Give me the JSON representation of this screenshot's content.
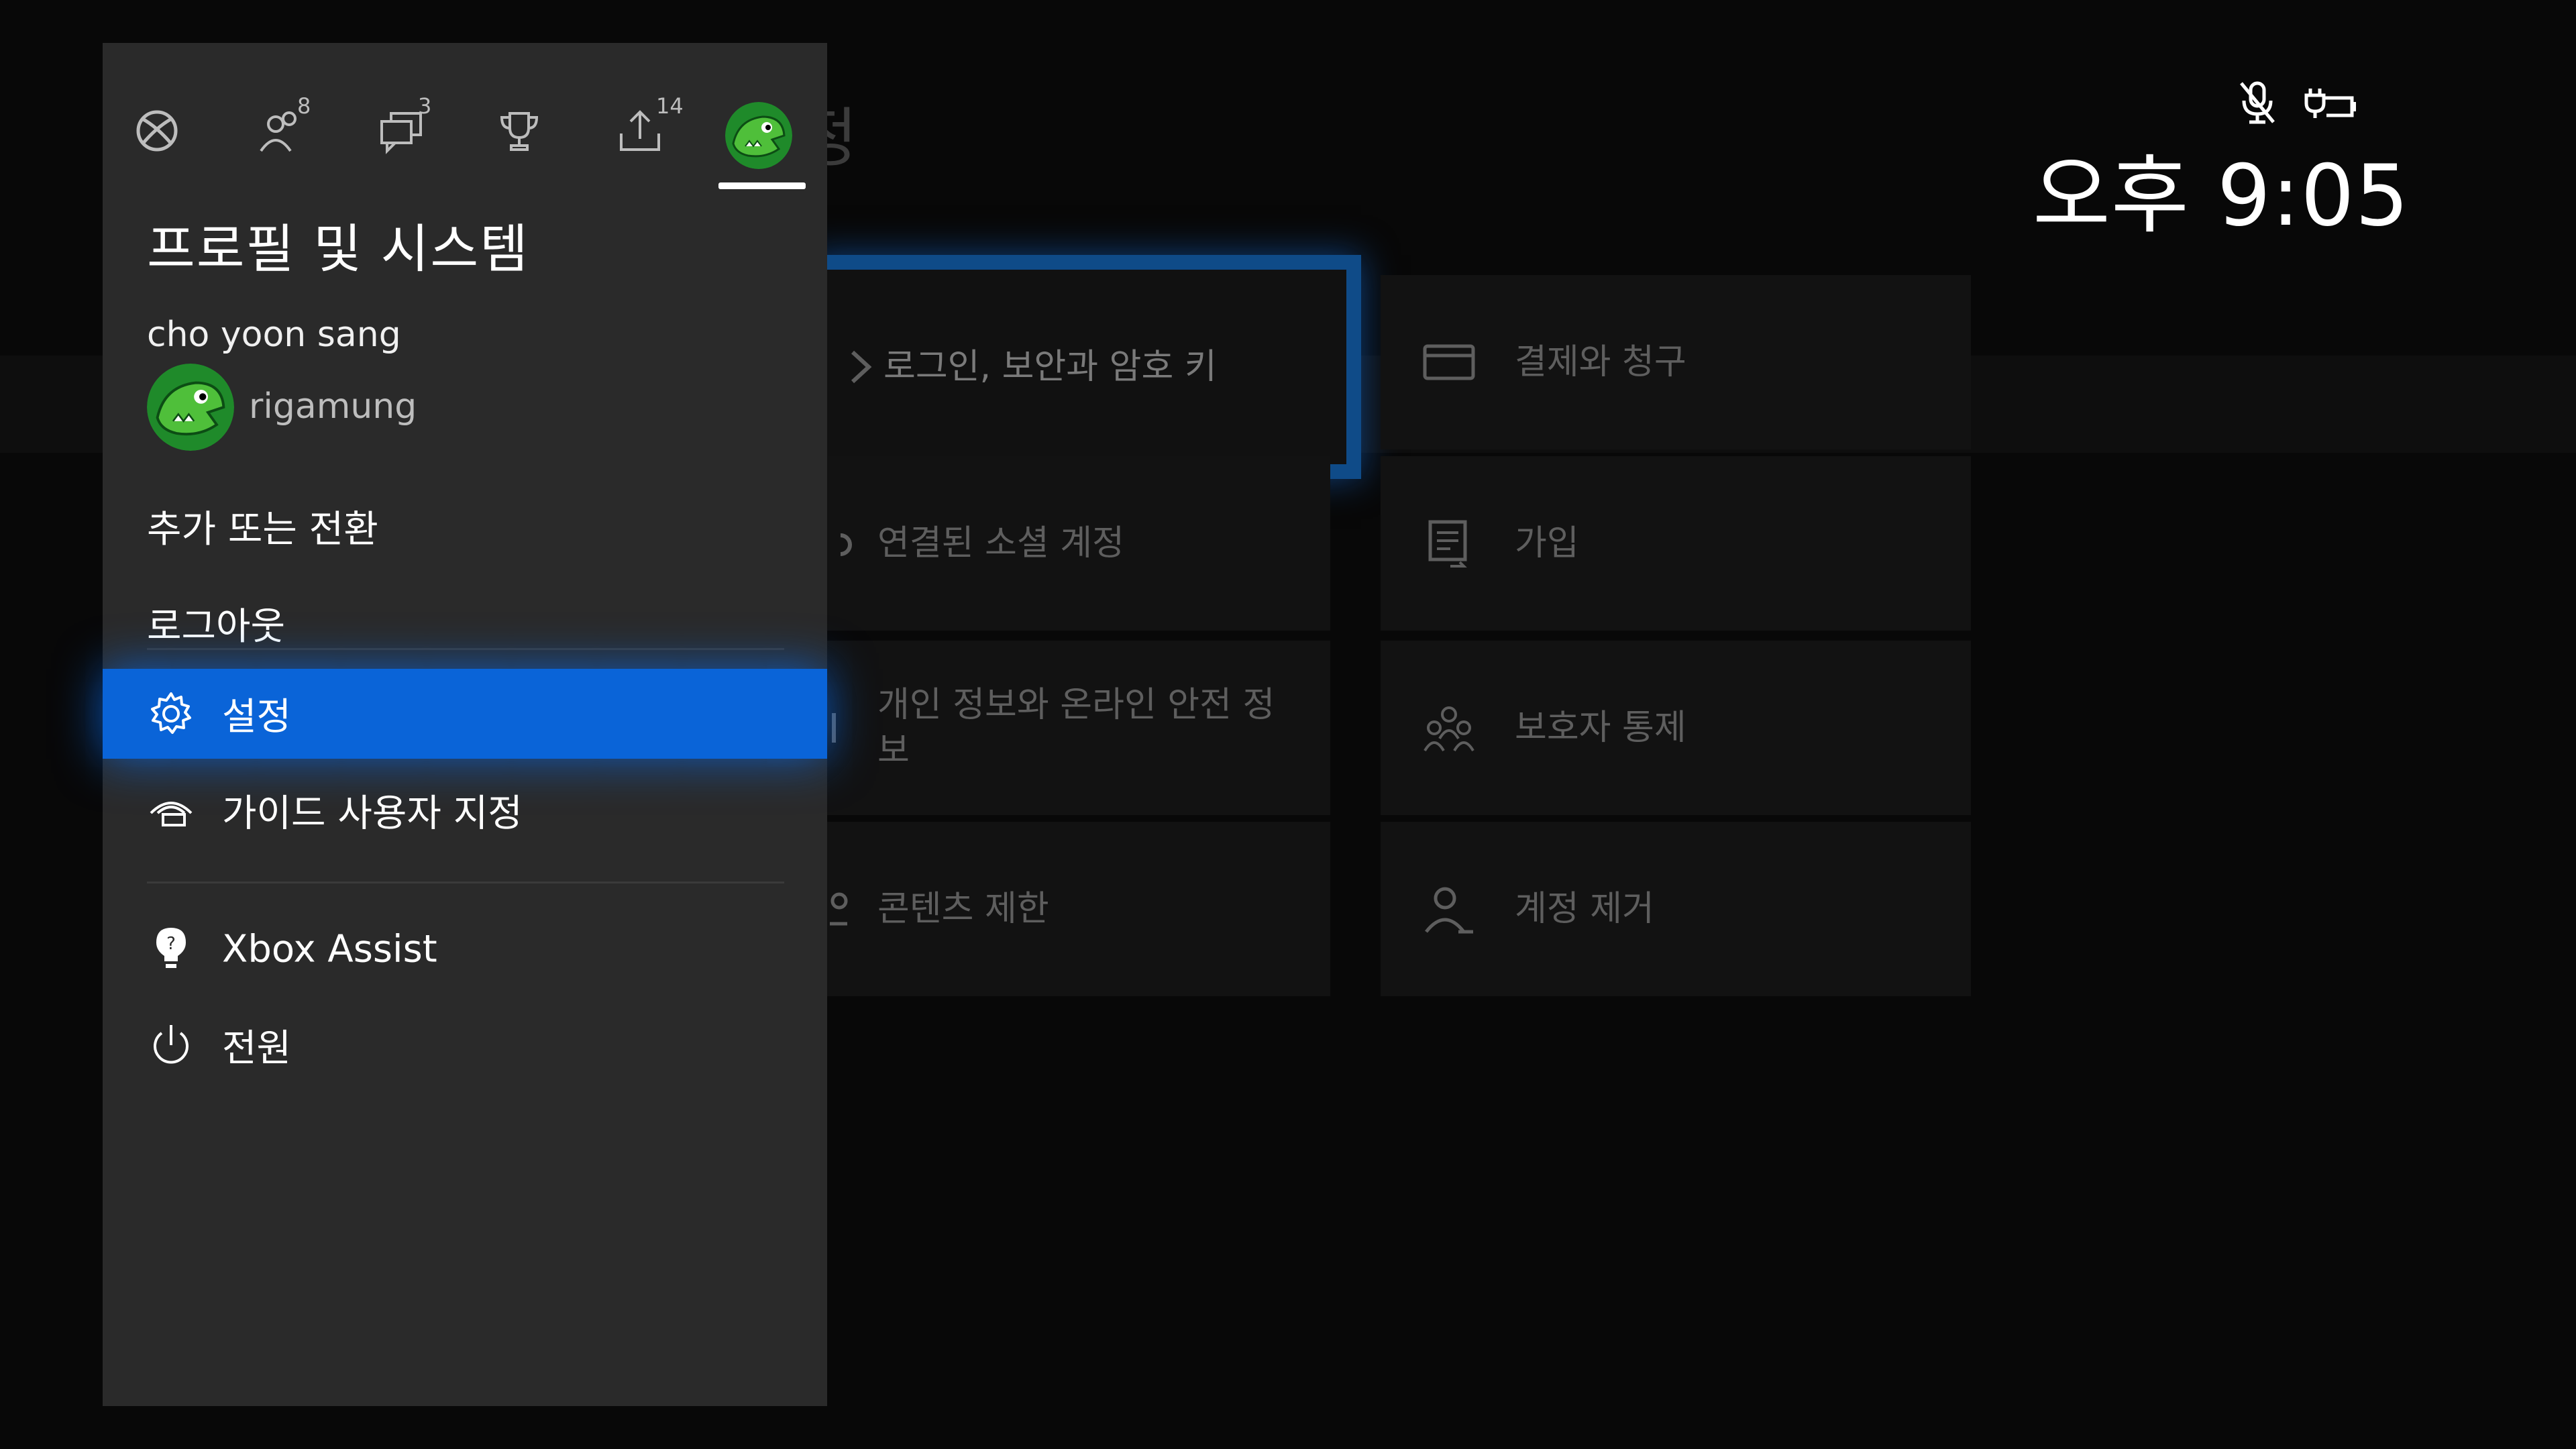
{
  "background": {
    "page_title": "정",
    "tiles": [
      {
        "label": "로그인, 보안과 암호 키",
        "icon": "login-arrow-icon"
      },
      {
        "label": "결제와 청구",
        "icon": "credit-card-icon"
      },
      {
        "label": "연결된 소셜 계정",
        "icon": "link-icon"
      },
      {
        "label": "가입",
        "icon": "subscription-icon"
      },
      {
        "label": "개인 정보와 온라인 안전 정보",
        "icon": "shield-icon"
      },
      {
        "label": "보호자 통제",
        "icon": "family-icon"
      },
      {
        "label": "콘텐츠 제한",
        "icon": "content-restriction-icon"
      },
      {
        "label": "계정 제거",
        "icon": "person-remove-icon"
      }
    ]
  },
  "status": {
    "clock": "오후 9:05",
    "icons": [
      "mic-muted-icon",
      "battery-charging-icon"
    ]
  },
  "guide": {
    "tabs": [
      {
        "name": "xbox-home-tab",
        "icon": "xbox-logo-icon",
        "badge": ""
      },
      {
        "name": "friends-tab",
        "icon": "people-icon",
        "badge": "8"
      },
      {
        "name": "messages-tab",
        "icon": "chat-icon",
        "badge": "3"
      },
      {
        "name": "achievements-tab",
        "icon": "trophy-icon",
        "badge": ""
      },
      {
        "name": "broadcast-tab",
        "icon": "upload-icon",
        "badge": "14"
      },
      {
        "name": "profile-tab",
        "icon": "avatar-icon",
        "badge": ""
      }
    ],
    "title": "프로필 및 시스템",
    "real_name": "cho yoon sang",
    "gamertag": "rigamung",
    "add_switch": "추가 또는 전환",
    "sign_out": "로그아웃",
    "settings": "설정",
    "customize_guide": "가이드 사용자 지정",
    "xbox_assist": "Xbox Assist",
    "power": "전원"
  },
  "colors": {
    "accent": "#0a64d8",
    "panel": "#2a2a2a",
    "background": "#080808",
    "focus_border": "#0f4b88"
  }
}
